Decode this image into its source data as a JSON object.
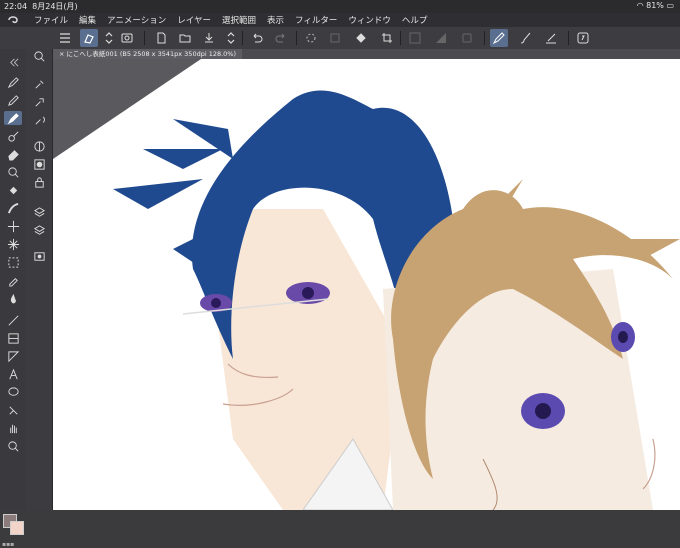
{
  "status": {
    "time": "22:04",
    "date": "8月24日(月)",
    "battery": "81%"
  },
  "menu": {
    "items": [
      "ファイル",
      "編集",
      "アニメーション",
      "レイヤー",
      "選択範囲",
      "表示",
      "フィルター",
      "ウィンドウ",
      "ヘルプ"
    ]
  },
  "document": {
    "tab_title": "にこへし表紙001 (B5 2508 x 3541px 350dpi 128.0%)"
  },
  "colors": {
    "main": "#8b7b7b",
    "sub": "#f2d4c8",
    "accent": "#5a6f8f"
  },
  "toolbar": {
    "icons": [
      "menu-icon",
      "quick-access-icon",
      "stepper-icon",
      "view-icon",
      "new-file-icon",
      "open-folder-icon",
      "save-icon",
      "upload-icon",
      "stepper-icon",
      "undo-icon",
      "redo-icon",
      "loading-icon",
      "clear-icon",
      "fill-icon",
      "crop-icon",
      "selection-icon",
      "invert-icon",
      "shape-icon",
      "pen-icon",
      "brush-icon",
      "ruler-icon",
      "help-icon"
    ]
  },
  "tools": {
    "icons": [
      "zoom-icon",
      "pen-icon",
      "pencil-icon",
      "brush-icon",
      "airbrush-icon",
      "eraser-icon",
      "decoration-icon",
      "fill-icon",
      "blend-icon",
      "move-icon",
      "sparkle-icon",
      "select-rect-icon",
      "eyedropper-icon",
      "figure-icon",
      "frame-icon",
      "ruler-icon",
      "text-icon",
      "balloon-icon",
      "correction-icon",
      "hand-icon",
      "zoom-icon"
    ]
  }
}
